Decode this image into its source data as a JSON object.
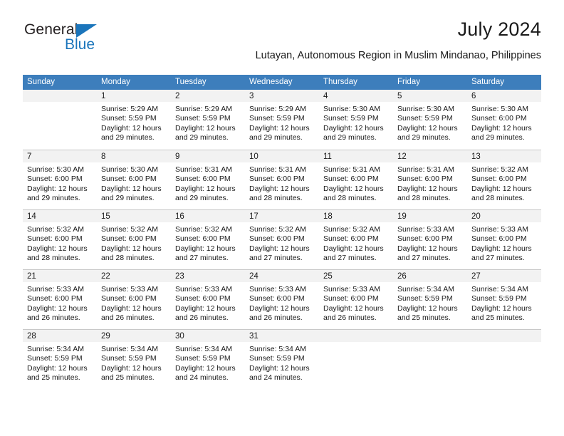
{
  "brand": {
    "name_top": "General",
    "name_bottom": "Blue",
    "triangle_color": "#1b75bb"
  },
  "header": {
    "title": "July 2024",
    "subtitle": "Lutayan, Autonomous Region in Muslim Mindanao, Philippines"
  },
  "calendar": {
    "header_bg": "#3d7ebc",
    "daynum_bg": "#f2f2f2",
    "weekdays": [
      "Sunday",
      "Monday",
      "Tuesday",
      "Wednesday",
      "Thursday",
      "Friday",
      "Saturday"
    ],
    "weeks": [
      [
        {
          "day": "",
          "sunrise": "",
          "sunset": "",
          "daylight1": "",
          "daylight2": ""
        },
        {
          "day": "1",
          "sunrise": "Sunrise: 5:29 AM",
          "sunset": "Sunset: 5:59 PM",
          "daylight1": "Daylight: 12 hours",
          "daylight2": "and 29 minutes."
        },
        {
          "day": "2",
          "sunrise": "Sunrise: 5:29 AM",
          "sunset": "Sunset: 5:59 PM",
          "daylight1": "Daylight: 12 hours",
          "daylight2": "and 29 minutes."
        },
        {
          "day": "3",
          "sunrise": "Sunrise: 5:29 AM",
          "sunset": "Sunset: 5:59 PM",
          "daylight1": "Daylight: 12 hours",
          "daylight2": "and 29 minutes."
        },
        {
          "day": "4",
          "sunrise": "Sunrise: 5:30 AM",
          "sunset": "Sunset: 5:59 PM",
          "daylight1": "Daylight: 12 hours",
          "daylight2": "and 29 minutes."
        },
        {
          "day": "5",
          "sunrise": "Sunrise: 5:30 AM",
          "sunset": "Sunset: 5:59 PM",
          "daylight1": "Daylight: 12 hours",
          "daylight2": "and 29 minutes."
        },
        {
          "day": "6",
          "sunrise": "Sunrise: 5:30 AM",
          "sunset": "Sunset: 6:00 PM",
          "daylight1": "Daylight: 12 hours",
          "daylight2": "and 29 minutes."
        }
      ],
      [
        {
          "day": "7",
          "sunrise": "Sunrise: 5:30 AM",
          "sunset": "Sunset: 6:00 PM",
          "daylight1": "Daylight: 12 hours",
          "daylight2": "and 29 minutes."
        },
        {
          "day": "8",
          "sunrise": "Sunrise: 5:30 AM",
          "sunset": "Sunset: 6:00 PM",
          "daylight1": "Daylight: 12 hours",
          "daylight2": "and 29 minutes."
        },
        {
          "day": "9",
          "sunrise": "Sunrise: 5:31 AM",
          "sunset": "Sunset: 6:00 PM",
          "daylight1": "Daylight: 12 hours",
          "daylight2": "and 29 minutes."
        },
        {
          "day": "10",
          "sunrise": "Sunrise: 5:31 AM",
          "sunset": "Sunset: 6:00 PM",
          "daylight1": "Daylight: 12 hours",
          "daylight2": "and 28 minutes."
        },
        {
          "day": "11",
          "sunrise": "Sunrise: 5:31 AM",
          "sunset": "Sunset: 6:00 PM",
          "daylight1": "Daylight: 12 hours",
          "daylight2": "and 28 minutes."
        },
        {
          "day": "12",
          "sunrise": "Sunrise: 5:31 AM",
          "sunset": "Sunset: 6:00 PM",
          "daylight1": "Daylight: 12 hours",
          "daylight2": "and 28 minutes."
        },
        {
          "day": "13",
          "sunrise": "Sunrise: 5:32 AM",
          "sunset": "Sunset: 6:00 PM",
          "daylight1": "Daylight: 12 hours",
          "daylight2": "and 28 minutes."
        }
      ],
      [
        {
          "day": "14",
          "sunrise": "Sunrise: 5:32 AM",
          "sunset": "Sunset: 6:00 PM",
          "daylight1": "Daylight: 12 hours",
          "daylight2": "and 28 minutes."
        },
        {
          "day": "15",
          "sunrise": "Sunrise: 5:32 AM",
          "sunset": "Sunset: 6:00 PM",
          "daylight1": "Daylight: 12 hours",
          "daylight2": "and 28 minutes."
        },
        {
          "day": "16",
          "sunrise": "Sunrise: 5:32 AM",
          "sunset": "Sunset: 6:00 PM",
          "daylight1": "Daylight: 12 hours",
          "daylight2": "and 27 minutes."
        },
        {
          "day": "17",
          "sunrise": "Sunrise: 5:32 AM",
          "sunset": "Sunset: 6:00 PM",
          "daylight1": "Daylight: 12 hours",
          "daylight2": "and 27 minutes."
        },
        {
          "day": "18",
          "sunrise": "Sunrise: 5:32 AM",
          "sunset": "Sunset: 6:00 PM",
          "daylight1": "Daylight: 12 hours",
          "daylight2": "and 27 minutes."
        },
        {
          "day": "19",
          "sunrise": "Sunrise: 5:33 AM",
          "sunset": "Sunset: 6:00 PM",
          "daylight1": "Daylight: 12 hours",
          "daylight2": "and 27 minutes."
        },
        {
          "day": "20",
          "sunrise": "Sunrise: 5:33 AM",
          "sunset": "Sunset: 6:00 PM",
          "daylight1": "Daylight: 12 hours",
          "daylight2": "and 27 minutes."
        }
      ],
      [
        {
          "day": "21",
          "sunrise": "Sunrise: 5:33 AM",
          "sunset": "Sunset: 6:00 PM",
          "daylight1": "Daylight: 12 hours",
          "daylight2": "and 26 minutes."
        },
        {
          "day": "22",
          "sunrise": "Sunrise: 5:33 AM",
          "sunset": "Sunset: 6:00 PM",
          "daylight1": "Daylight: 12 hours",
          "daylight2": "and 26 minutes."
        },
        {
          "day": "23",
          "sunrise": "Sunrise: 5:33 AM",
          "sunset": "Sunset: 6:00 PM",
          "daylight1": "Daylight: 12 hours",
          "daylight2": "and 26 minutes."
        },
        {
          "day": "24",
          "sunrise": "Sunrise: 5:33 AM",
          "sunset": "Sunset: 6:00 PM",
          "daylight1": "Daylight: 12 hours",
          "daylight2": "and 26 minutes."
        },
        {
          "day": "25",
          "sunrise": "Sunrise: 5:33 AM",
          "sunset": "Sunset: 6:00 PM",
          "daylight1": "Daylight: 12 hours",
          "daylight2": "and 26 minutes."
        },
        {
          "day": "26",
          "sunrise": "Sunrise: 5:34 AM",
          "sunset": "Sunset: 5:59 PM",
          "daylight1": "Daylight: 12 hours",
          "daylight2": "and 25 minutes."
        },
        {
          "day": "27",
          "sunrise": "Sunrise: 5:34 AM",
          "sunset": "Sunset: 5:59 PM",
          "daylight1": "Daylight: 12 hours",
          "daylight2": "and 25 minutes."
        }
      ],
      [
        {
          "day": "28",
          "sunrise": "Sunrise: 5:34 AM",
          "sunset": "Sunset: 5:59 PM",
          "daylight1": "Daylight: 12 hours",
          "daylight2": "and 25 minutes."
        },
        {
          "day": "29",
          "sunrise": "Sunrise: 5:34 AM",
          "sunset": "Sunset: 5:59 PM",
          "daylight1": "Daylight: 12 hours",
          "daylight2": "and 25 minutes."
        },
        {
          "day": "30",
          "sunrise": "Sunrise: 5:34 AM",
          "sunset": "Sunset: 5:59 PM",
          "daylight1": "Daylight: 12 hours",
          "daylight2": "and 24 minutes."
        },
        {
          "day": "31",
          "sunrise": "Sunrise: 5:34 AM",
          "sunset": "Sunset: 5:59 PM",
          "daylight1": "Daylight: 12 hours",
          "daylight2": "and 24 minutes."
        },
        {
          "day": "",
          "sunrise": "",
          "sunset": "",
          "daylight1": "",
          "daylight2": ""
        },
        {
          "day": "",
          "sunrise": "",
          "sunset": "",
          "daylight1": "",
          "daylight2": ""
        },
        {
          "day": "",
          "sunrise": "",
          "sunset": "",
          "daylight1": "",
          "daylight2": ""
        }
      ]
    ]
  }
}
